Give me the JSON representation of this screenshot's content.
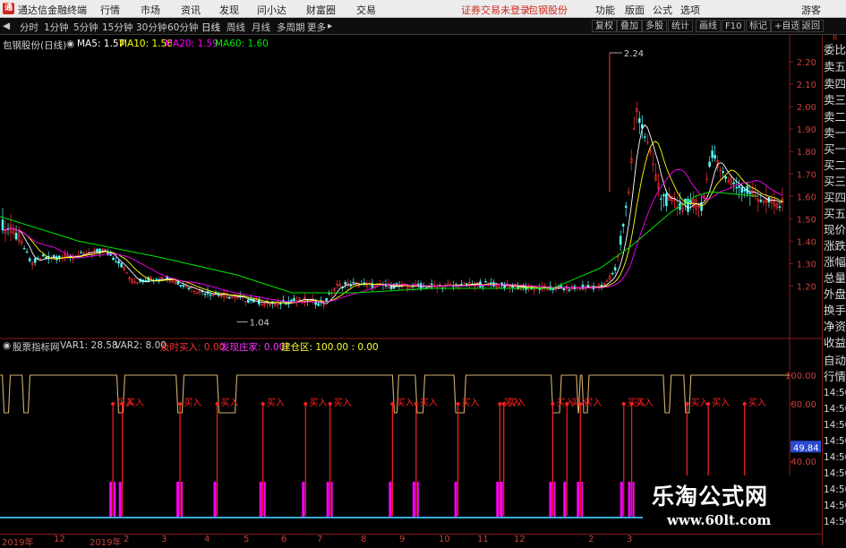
{
  "menubar": {
    "app_title": "通达信金融终端",
    "items": [
      "行情",
      "市场",
      "资讯",
      "发现",
      "问小达",
      "财富圈",
      "交易"
    ],
    "notice": "证券交易未登录",
    "stock_name": "包钢股份",
    "right_items": [
      "功能",
      "版面",
      "公式",
      "选项"
    ],
    "guest": "游客"
  },
  "toolbar": {
    "periods": [
      "分时",
      "1分钟",
      "5分钟",
      "15分钟",
      "30分钟",
      "60分钟",
      "日线",
      "周线",
      "月线",
      "多周期",
      "更多"
    ],
    "active_period": "日线",
    "right_buttons": [
      "复权",
      "叠加",
      "多股",
      "统计",
      "画线",
      "F10",
      "标记",
      "+自选",
      "返回"
    ]
  },
  "main_chart": {
    "title": "包钢股份(日线)",
    "ma5": "MA5: 1.57",
    "ma10": "MA10: 1.56",
    "ma20": "MA20: 1.59",
    "ma60": "MA60: 1.60",
    "high_label": "2.24",
    "low_label": "1.04",
    "price_ticks": [
      "2.20",
      "2.10",
      "2.00",
      "1.90",
      "1.80",
      "1.70",
      "1.60",
      "1.50",
      "1.40",
      "1.30",
      "1.20"
    ]
  },
  "indicator": {
    "name": "股票指标网",
    "var1": "VAR1: 28.58",
    "var2": "VAR2: 8.00",
    "buy_label": "及时买入: 0.00",
    "zhuang_label": "发现庄家: 0.00",
    "warehouse_label": "建仓区: 100.00 : 0.00",
    "buy_text": "买入",
    "ticks": [
      "100.00",
      "80.00",
      "40.00"
    ],
    "current_value": "49.84"
  },
  "right_panel": {
    "items": [
      "委比",
      "卖五",
      "卖四",
      "卖三",
      "卖二",
      "卖一",
      "买一",
      "买二",
      "买三",
      "买四",
      "买五",
      "现价",
      "涨跌",
      "涨幅",
      "总量",
      "外盘",
      "换手",
      "净资",
      "收益"
    ],
    "tabs": [
      "自动",
      "行情"
    ],
    "times": [
      "14:50",
      "14:50",
      "14:50",
      "14:50",
      "14:50",
      "14:50",
      "14:50",
      "14:50",
      "14:50"
    ],
    "top_marker": "R"
  },
  "date_axis": [
    "2019年",
    "12",
    "2019年",
    "2",
    "3",
    "4",
    "5",
    "6",
    "7",
    "8",
    "9",
    "10",
    "11",
    "12",
    "2",
    "3"
  ],
  "watermark": {
    "title": "乐淘公式网",
    "url": "www.60lt.com"
  },
  "colors": {
    "background": "#000000",
    "up": "#ff3232",
    "down": "#54ffff",
    "ma5": "#ffffff",
    "ma10": "#ffff00",
    "ma20": "#ff00ff",
    "ma60": "#00e600",
    "grid": "#8a1a1a",
    "var_line": "#d4b06a",
    "buy": "#ff2020",
    "magenta_bar": "#ff00ff",
    "cyan_line": "#3aa8d8"
  },
  "chart_data": {
    "type": "candlestick",
    "title": "包钢股份(日线)",
    "price_axis": [
      1.0,
      2.3
    ],
    "price_ticks": [
      1.2,
      1.3,
      1.4,
      1.5,
      1.6,
      1.7,
      1.8,
      1.9,
      2.0,
      2.1,
      2.2
    ],
    "high": 2.24,
    "low": 1.04,
    "ma_last": {
      "MA5": 1.57,
      "MA10": 1.56,
      "MA20": 1.59,
      "MA60": 1.6
    },
    "price_path": [
      [
        0,
        1.47
      ],
      [
        0.02,
        1.42
      ],
      [
        0.035,
        1.3
      ],
      [
        0.05,
        1.33
      ],
      [
        0.08,
        1.33
      ],
      [
        0.1,
        1.34
      ],
      [
        0.125,
        1.36
      ],
      [
        0.145,
        1.3
      ],
      [
        0.16,
        1.22
      ],
      [
        0.2,
        1.24
      ],
      [
        0.24,
        1.18
      ],
      [
        0.27,
        1.16
      ],
      [
        0.3,
        1.14
      ],
      [
        0.33,
        1.12
      ],
      [
        0.37,
        1.14
      ],
      [
        0.395,
        1.12
      ],
      [
        0.41,
        1.2
      ],
      [
        0.43,
        1.21
      ],
      [
        0.47,
        1.2
      ],
      [
        0.5,
        1.2
      ],
      [
        0.55,
        1.2
      ],
      [
        0.6,
        1.21
      ],
      [
        0.65,
        1.19
      ],
      [
        0.7,
        1.19
      ],
      [
        0.74,
        1.2
      ],
      [
        0.755,
        1.28
      ],
      [
        0.77,
        1.6
      ],
      [
        0.78,
        2.0
      ],
      [
        0.79,
        1.88
      ],
      [
        0.8,
        1.75
      ],
      [
        0.81,
        1.6
      ],
      [
        0.83,
        1.56
      ],
      [
        0.86,
        1.56
      ],
      [
        0.875,
        1.8
      ],
      [
        0.89,
        1.68
      ],
      [
        0.91,
        1.64
      ],
      [
        0.925,
        1.61
      ],
      [
        0.945,
        1.57
      ],
      [
        0.96,
        1.56
      ]
    ],
    "ma60_path": [
      [
        0,
        1.51
      ],
      [
        0.1,
        1.4
      ],
      [
        0.2,
        1.33
      ],
      [
        0.3,
        1.25
      ],
      [
        0.37,
        1.17
      ],
      [
        0.45,
        1.17
      ],
      [
        0.55,
        1.19
      ],
      [
        0.7,
        1.19
      ],
      [
        0.76,
        1.28
      ],
      [
        0.8,
        1.38
      ],
      [
        0.85,
        1.53
      ],
      [
        0.88,
        1.6
      ],
      [
        0.9,
        1.62
      ],
      [
        0.96,
        1.6
      ]
    ],
    "indicator": {
      "var1": 28.58,
      "var2": 8.0,
      "current": 49.84,
      "y_axis": [
        0,
        110
      ],
      "ticks": [
        40,
        80,
        100
      ],
      "low_dips": [
        [
          0.003,
          0.013
        ],
        [
          0.028,
          0.038
        ],
        [
          0.148,
          0.158
        ],
        [
          0.223,
          0.233
        ],
        [
          0.275,
          0.3
        ],
        [
          0.497,
          0.505
        ],
        [
          0.526,
          0.538
        ],
        [
          0.575,
          0.59
        ],
        [
          0.698,
          0.711
        ],
        [
          0.73,
          0.735
        ],
        [
          0.737,
          0.746
        ],
        [
          0.84,
          0.85
        ],
        [
          0.866,
          0.875
        ]
      ],
      "buy_signals": [
        0.143,
        0.155,
        0.228,
        0.275,
        0.333,
        0.387,
        0.418,
        0.497,
        0.527,
        0.58,
        0.633,
        0.638,
        0.7,
        0.718,
        0.735,
        0.79,
        0.8,
        0.87,
        0.897,
        0.943
      ]
    }
  }
}
